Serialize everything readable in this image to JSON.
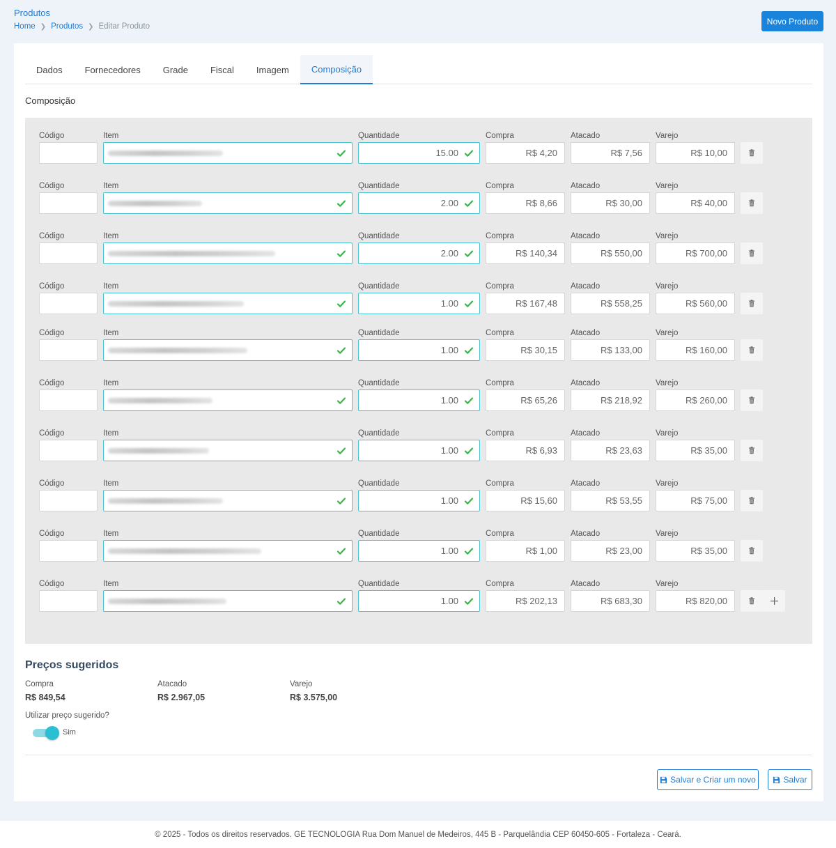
{
  "header": {
    "title": "Produtos",
    "breadcrumb": [
      "Home",
      "Produtos",
      "Editar Produto"
    ],
    "new_button": "Novo Produto"
  },
  "tabs": [
    "Dados",
    "Fornecedores",
    "Grade",
    "Fiscal",
    "Imagem",
    "Composição"
  ],
  "active_tab": "Composição",
  "section_title": "Composição",
  "columns": {
    "codigo": "Código",
    "item": "Item",
    "quantidade": "Quantidade",
    "compra": "Compra",
    "atacado": "Atacado",
    "varejo": "Varejo"
  },
  "rows": [
    {
      "codigo": "",
      "quantidade": "15.00",
      "compra": "R$ 4,20",
      "atacado": "R$ 7,56",
      "varejo": "R$ 10,00"
    },
    {
      "codigo": "",
      "quantidade": "2.00",
      "compra": "R$ 8,66",
      "atacado": "R$ 30,00",
      "varejo": "R$ 40,00"
    },
    {
      "codigo": "",
      "quantidade": "2.00",
      "compra": "R$ 140,34",
      "atacado": "R$ 550,00",
      "varejo": "R$ 700,00"
    },
    {
      "codigo": "",
      "quantidade": "1.00",
      "compra": "R$ 167,48",
      "atacado": "R$ 558,25",
      "varejo": "R$ 560,00"
    },
    {
      "codigo": "",
      "quantidade": "1.00",
      "compra": "R$ 30,15",
      "atacado": "R$ 133,00",
      "varejo": "R$ 160,00"
    },
    {
      "codigo": "",
      "quantidade": "1.00",
      "compra": "R$ 65,26",
      "atacado": "R$ 218,92",
      "varejo": "R$ 260,00"
    },
    {
      "codigo": "",
      "quantidade": "1.00",
      "compra": "R$ 6,93",
      "atacado": "R$ 23,63",
      "varejo": "R$ 35,00"
    },
    {
      "codigo": "",
      "quantidade": "1.00",
      "compra": "R$ 15,60",
      "atacado": "R$ 53,55",
      "varejo": "R$ 75,00"
    },
    {
      "codigo": "",
      "quantidade": "1.00",
      "compra": "R$ 1,00",
      "atacado": "R$ 23,00",
      "varejo": "R$ 35,00"
    },
    {
      "codigo": "",
      "quantidade": "1.00",
      "compra": "R$ 202,13",
      "atacado": "R$ 683,30",
      "varejo": "R$ 820,00"
    }
  ],
  "suggested": {
    "title": "Preços sugeridos",
    "compra_label": "Compra",
    "compra_value": "R$ 849,54",
    "atacado_label": "Atacado",
    "atacado_value": "R$ 2.967,05",
    "varejo_label": "Varejo",
    "varejo_value": "R$ 3.575,00",
    "use_label": "Utilizar preço sugerido?",
    "toggle_on": true,
    "toggle_text": "Sim"
  },
  "actions": {
    "save_and_new": "Salvar e Criar um novo",
    "save": "Salvar"
  },
  "footer": "© 2025 - Todos os direitos reservados. GE TECNOLOGIA Rua Dom Manuel de Medeiros, 445 B - Parquelândia CEP 60450-605 - Fortaleza - Ceará.",
  "colors": {
    "primary": "#1e7bd6",
    "valid_border": "#49c2d1",
    "check": "#3bb54a",
    "toggle": "#2bbfd3"
  },
  "icons": [
    "chevron-right-icon",
    "check-icon",
    "trash-icon",
    "plus-icon",
    "save-icon"
  ]
}
